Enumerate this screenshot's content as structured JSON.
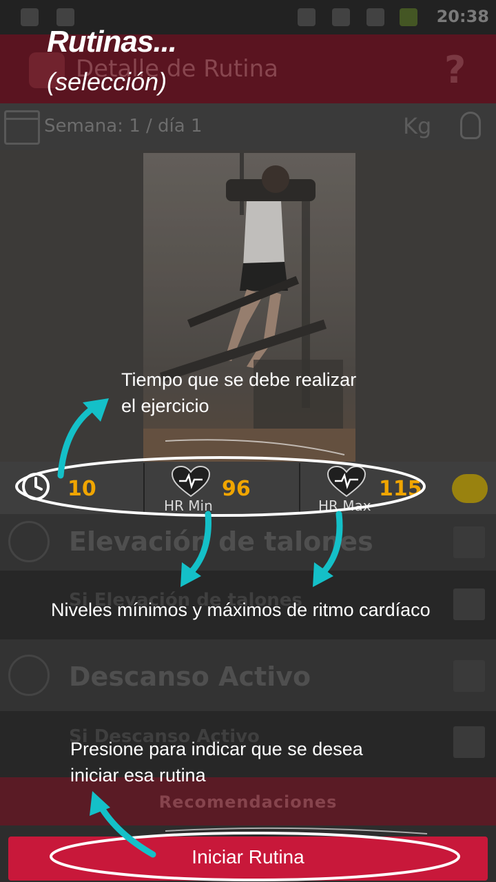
{
  "status_bar": {
    "time": "20:38"
  },
  "action_bar": {
    "title": "Detalle de Rutina",
    "help": "?"
  },
  "week_bar": {
    "label": "Semana: 1 / día 1",
    "unit": "Kg"
  },
  "stats": {
    "time_value": "10",
    "hr_min_value": "96",
    "hr_min_label": "HR Min",
    "hr_max_value": "115",
    "hr_max_label": "HR Max"
  },
  "list": [
    {
      "label": "Elevación de talones"
    },
    {
      "label": "Si Elevación de talones"
    },
    {
      "label": "Descanso Activo"
    },
    {
      "label": "Si Descanso Activo"
    }
  ],
  "recommendations_label": "Recomendaciones",
  "start_button_label": "Iniciar Rutina",
  "overlay": {
    "heading": "Rutinas...",
    "subheading": "(selección)",
    "note_time_line1": "Tiempo que se debe realizar",
    "note_time_line2": "el ejercicio",
    "note_hr": "Niveles mínimos y máximos de ritmo cardíaco",
    "note_start_line1": "Presione para indicar que se desea",
    "note_start_line2": "iniciar esa rutina"
  },
  "colors": {
    "accent": "#c8183a",
    "value_orange": "#f0a500",
    "arrow_cyan": "#14c0c8"
  }
}
